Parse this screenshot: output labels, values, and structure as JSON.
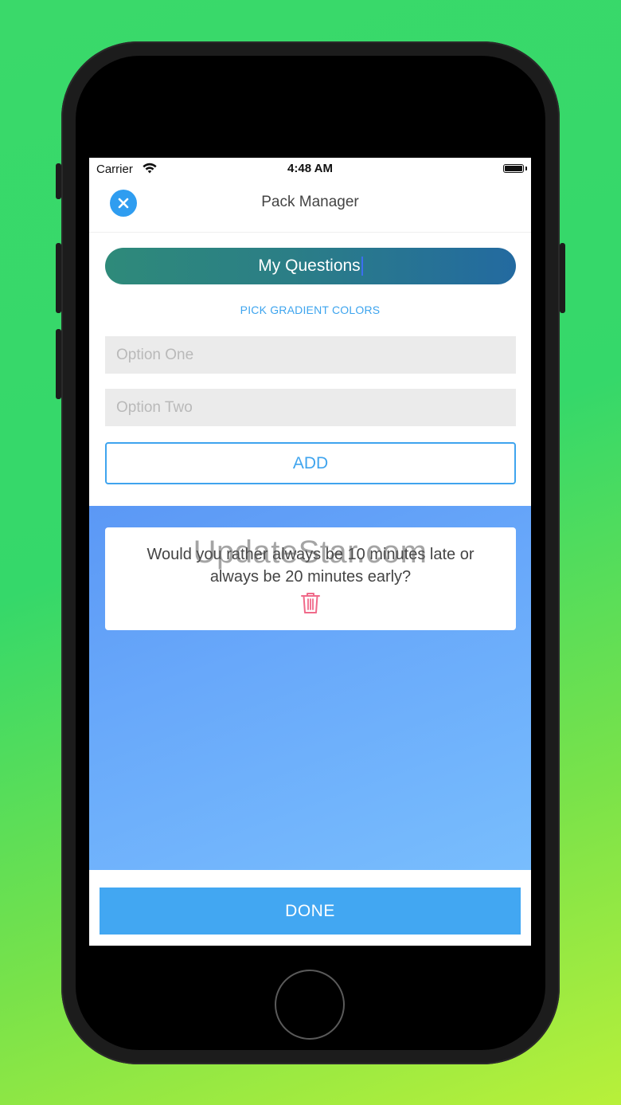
{
  "status_bar": {
    "carrier": "Carrier",
    "time": "4:48 AM"
  },
  "nav": {
    "title": "Pack Manager",
    "close_icon": "close-x-icon"
  },
  "pack": {
    "name": "My Questions",
    "pick_gradient_label": "PICK GRADIENT COLORS"
  },
  "form": {
    "option_one_placeholder": "Option One",
    "option_two_placeholder": "Option Two",
    "add_label": "ADD"
  },
  "questions": [
    {
      "text": "Would you rather always be 10 minutes late or always be 20 minutes early?",
      "delete_icon": "trash-icon"
    }
  ],
  "watermark": "UpdateStar.com",
  "footer": {
    "done_label": "DONE"
  },
  "colors": {
    "accent": "#42a7f2",
    "gradient_start": "#2e8a7a",
    "gradient_end": "#236aa0",
    "delete": "#f06a8a"
  }
}
